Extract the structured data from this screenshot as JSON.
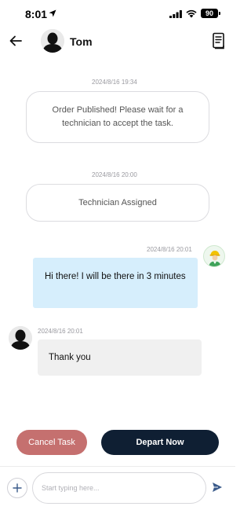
{
  "status_bar": {
    "time": "8:01",
    "battery": "90",
    "icons": [
      "location-arrow-icon",
      "signal-icon",
      "wifi-icon",
      "battery-icon"
    ]
  },
  "header": {
    "contact_name": "Tom",
    "back_icon": "back-arrow-icon",
    "order_icon": "document-icon"
  },
  "messages": [
    {
      "type": "system",
      "timestamp": "2024/8/16 19:34",
      "text": "Order Published! Please wait for a technician to accept the task."
    },
    {
      "type": "system",
      "timestamp": "2024/8/16 20:00",
      "text": "Technician Assigned"
    },
    {
      "type": "outgoing",
      "timestamp": "2024/8/16 20:01",
      "text": "Hi there! I will be there in 3 minutes"
    },
    {
      "type": "incoming",
      "timestamp": "2024/8/16 20:01",
      "text": "Thank you"
    }
  ],
  "actions": {
    "cancel_label": "Cancel Task",
    "depart_label": "Depart Now"
  },
  "composer": {
    "placeholder": "Start typing here...",
    "value": ""
  },
  "colors": {
    "outgoing_bubble": "#d6eefc",
    "incoming_bubble": "#f0f0f0",
    "cancel_button": "#c5706f",
    "depart_button": "#0f1f33"
  }
}
